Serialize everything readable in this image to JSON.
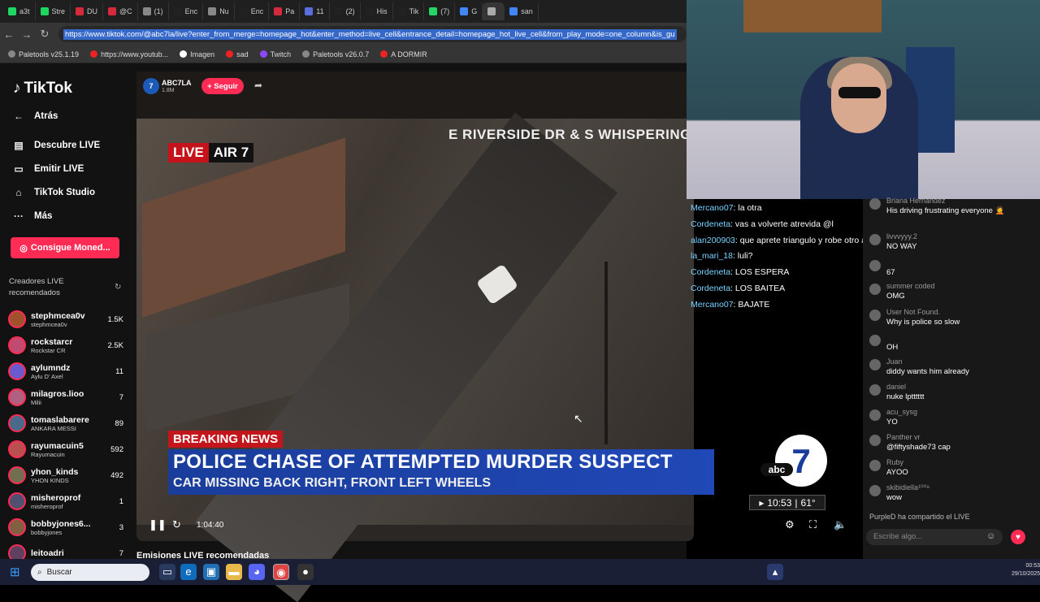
{
  "browser": {
    "tabs": [
      "a3t",
      "Stre",
      "DU",
      "@C",
      "(1)",
      "Enc",
      "Nu",
      "Enc",
      "Pa",
      "11",
      "(2)",
      "His",
      "Tik",
      "(7)",
      "G",
      "",
      "san"
    ],
    "url": "https://www.tiktok.com/@abc7la/live?enter_from_merge=homepage_hot&enter_method=live_cell&entrance_detail=homepage_hot_live_cell&from_play_mode=one_column&is_gu",
    "bookmarks": [
      "Paletools v25.1.19",
      "https://www.youtub...",
      "Imagen",
      "sad",
      "Twitch",
      "Paletools v26.0.7",
      "A DORMIR"
    ]
  },
  "sidebar": {
    "logo": "TikTok",
    "back": "Atrás",
    "nav": [
      {
        "label": "Descubre LIVE",
        "icon": "live-icon"
      },
      {
        "label": "Emitir LIVE",
        "icon": "camera-icon"
      },
      {
        "label": "TikTok Studio",
        "icon": "home-icon"
      },
      {
        "label": "Más",
        "icon": "more-icon"
      }
    ],
    "coins_button": "Consigue Moned...",
    "recommended_title": "Creadores LIVE recomendados",
    "creators": [
      {
        "name": "stephmcea0v",
        "sub": "stephmcea0v",
        "count": "1.5K"
      },
      {
        "name": "rockstarcr",
        "sub": "Rockstar CR",
        "count": "2.5K"
      },
      {
        "name": "aylumndz",
        "sub": "Aylu D' Axel",
        "count": "11"
      },
      {
        "name": "milagros.lioo",
        "sub": "Milii",
        "count": "7"
      },
      {
        "name": "tomaslabarere",
        "sub": "ANKARA MESSI",
        "count": "89"
      },
      {
        "name": "rayumacuin5",
        "sub": "Rayumacuin",
        "count": "592"
      },
      {
        "name": "yhon_kinds",
        "sub": "YHON KINDS",
        "count": "492"
      },
      {
        "name": "misheroprof",
        "sub": "misheroprof",
        "count": "1"
      },
      {
        "name": "bobbyjones6...",
        "sub": "bobbyjones",
        "count": "3"
      },
      {
        "name": "leitoadri",
        "sub": "",
        "count": "7"
      }
    ]
  },
  "stream": {
    "host": "ABC7LA",
    "host_likes": "1.8M",
    "follow": "+ Seguir",
    "street": "E RIVERSIDE DR & S WHISPERING L",
    "live_label": "LIVE",
    "air_label": "AIR 7",
    "breaking": "BREAKING NEWS",
    "headline": "POLICE CHASE OF ATTEMPTED MURDER SUSPECT",
    "subheadline": "CAR MISSING BACK RIGHT, FRONT LEFT WHEELS",
    "clock": "10:53",
    "temp": "61°",
    "elapsed": "1:04:40",
    "below_title": "Emisiones LIVE recomendadas"
  },
  "overlay_chat": [
    {
      "user": "Mercano07",
      "text": ": la otra"
    },
    {
      "user": "Cordeneta",
      "text": ": vas a volverte atrevida @l"
    },
    {
      "user": "alan200903",
      "text": ": que aprete triangulo y robe otro auto"
    },
    {
      "user": "la_mari_18",
      "text": ": luli?"
    },
    {
      "user": "Cordeneta",
      "text": ": LOS ESPERA"
    },
    {
      "user": "Cordeneta",
      "text": ": LOS BAITEA"
    },
    {
      "user": "Mercano07",
      "text": ": BAJATE"
    }
  ],
  "chat": {
    "messages": [
      {
        "user": "Briana Hernandez",
        "text": "His driving frustrating everyone 🤦"
      },
      {
        "user": "livvvyyy.2",
        "text": "NO WAY"
      },
      {
        "user": "",
        "text": "67"
      },
      {
        "user": "summer coded",
        "text": "OMG"
      },
      {
        "user": "User Not Found.",
        "text": "Why is police so slow"
      },
      {
        "user": "",
        "text": "OH"
      },
      {
        "user": "Juan",
        "text": "diddy wants him already"
      },
      {
        "user": "daniel",
        "text": "nuke lptttttt"
      },
      {
        "user": "acu_sysg",
        "text": "YO"
      },
      {
        "user": "Panther vr",
        "text": "@fiftyshade73 cap"
      },
      {
        "user": "Ruby",
        "text": "AYOO"
      },
      {
        "user": "skibidiella¹⁰⁰⁹",
        "text": "wow"
      }
    ],
    "shared_notice": "PurpleD  ha compartido el LIVE",
    "input_placeholder": "Escribe algo..."
  },
  "taskbar": {
    "search": "Buscar",
    "time": "00:53",
    "date": "29/10/2025"
  },
  "colors": {
    "brand": "#fe2c55",
    "headline_bg": "#2048b6",
    "live_red": "#c6121a"
  }
}
